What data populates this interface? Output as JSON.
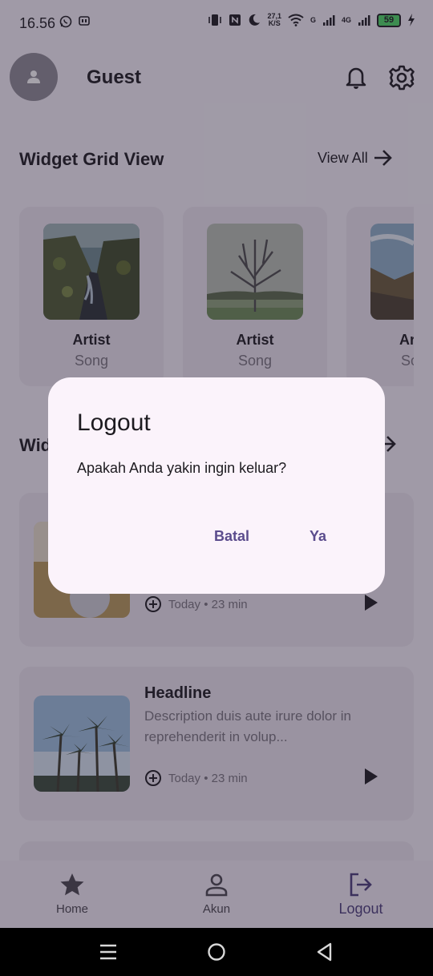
{
  "status_bar": {
    "time": "16.56",
    "net_speed_value": "27,1",
    "net_speed_unit": "K/S",
    "sig1": "G",
    "sig2": "4G",
    "battery": "59"
  },
  "header": {
    "user_name": "Guest"
  },
  "grid_section": {
    "title": "Widget Grid View",
    "view_all": "View All",
    "cards": [
      {
        "artist": "Artist",
        "song": "Song"
      },
      {
        "artist": "Artist",
        "song": "Song"
      },
      {
        "artist": "Artist",
        "song": "Song"
      }
    ]
  },
  "list_section": {
    "title_partial": "Wid",
    "cards": [
      {
        "meta": "Today • 23 min"
      },
      {
        "headline": "Headline",
        "description": "Description duis aute irure dolor in reprehenderit in volup...",
        "meta": "Today • 23 min"
      }
    ]
  },
  "bottom_nav": {
    "items": [
      {
        "label": "Home",
        "icon": "star-icon"
      },
      {
        "label": "Akun",
        "icon": "person-icon"
      },
      {
        "label": "Logout",
        "icon": "logout-icon",
        "active": true
      }
    ]
  },
  "dialog": {
    "title": "Logout",
    "message": "Apakah Anda yakin ingin keluar?",
    "cancel": "Batal",
    "confirm": "Ya"
  },
  "colors": {
    "background": "#f7f2fa",
    "card": "#ece6f0",
    "accent": "#5b4c8d",
    "dialog": "#fbf3fb"
  }
}
